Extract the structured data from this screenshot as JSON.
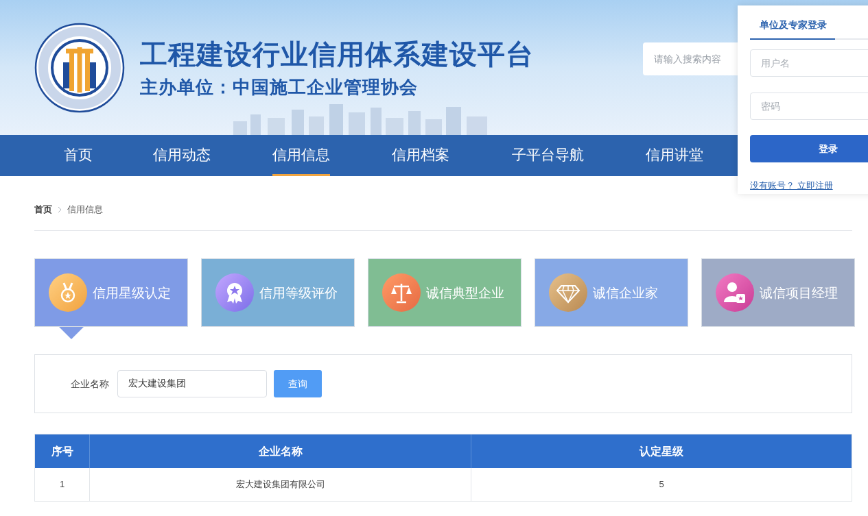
{
  "header": {
    "title": "工程建设行业信用体系建设平台",
    "subtitle": "主办单位：中国施工企业管理协会",
    "search": {
      "placeholder": "请输入搜索内容"
    }
  },
  "nav": [
    {
      "label": "首页",
      "selected": false
    },
    {
      "label": "信用动态",
      "selected": false
    },
    {
      "label": "信用信息",
      "selected": true
    },
    {
      "label": "信用档案",
      "selected": false
    },
    {
      "label": "子平台导航",
      "selected": false
    },
    {
      "label": "信用讲堂",
      "selected": false
    }
  ],
  "login": {
    "tab": "单位及专家登录",
    "username": {
      "placeholder": "用户名"
    },
    "password": {
      "placeholder": "密码"
    },
    "button": "登录",
    "register_link": "没有账号？ 立即注册"
  },
  "breadcrumb": [
    "首页",
    "信用信息"
  ],
  "categories": [
    {
      "label": "信用星级认定",
      "kind": "medal",
      "color": "#7f9be6",
      "selected": true
    },
    {
      "label": "信用等级评价",
      "kind": "badge",
      "color": "#7aafd6",
      "selected": false
    },
    {
      "label": "诚信典型企业",
      "kind": "scale",
      "color": "#80bd93",
      "selected": false
    },
    {
      "label": "诚信企业家",
      "kind": "diamond",
      "color": "#87a9e6",
      "selected": false
    },
    {
      "label": "诚信项目经理",
      "kind": "person",
      "color": "#9eabc6",
      "selected": false
    }
  ],
  "filter": {
    "label": "企业名称",
    "value": "宏大建设集团",
    "button": "查询"
  },
  "table": {
    "columns": [
      "序号",
      "企业名称",
      "认定星级"
    ],
    "rows": [
      [
        "1",
        "宏大建设集团有限公司",
        "5"
      ]
    ]
  }
}
